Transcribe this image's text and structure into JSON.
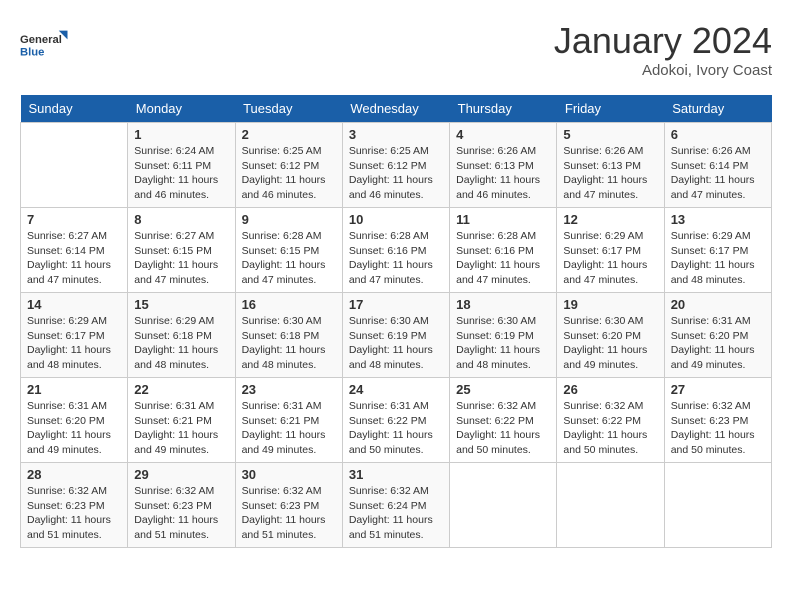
{
  "header": {
    "logo_line1": "General",
    "logo_line2": "Blue",
    "month_year": "January 2024",
    "location": "Adokoi, Ivory Coast"
  },
  "days_of_week": [
    "Sunday",
    "Monday",
    "Tuesday",
    "Wednesday",
    "Thursday",
    "Friday",
    "Saturday"
  ],
  "weeks": [
    [
      {
        "num": "",
        "sunrise": "",
        "sunset": "",
        "daylight": ""
      },
      {
        "num": "1",
        "sunrise": "Sunrise: 6:24 AM",
        "sunset": "Sunset: 6:11 PM",
        "daylight": "Daylight: 11 hours and 46 minutes."
      },
      {
        "num": "2",
        "sunrise": "Sunrise: 6:25 AM",
        "sunset": "Sunset: 6:12 PM",
        "daylight": "Daylight: 11 hours and 46 minutes."
      },
      {
        "num": "3",
        "sunrise": "Sunrise: 6:25 AM",
        "sunset": "Sunset: 6:12 PM",
        "daylight": "Daylight: 11 hours and 46 minutes."
      },
      {
        "num": "4",
        "sunrise": "Sunrise: 6:26 AM",
        "sunset": "Sunset: 6:13 PM",
        "daylight": "Daylight: 11 hours and 46 minutes."
      },
      {
        "num": "5",
        "sunrise": "Sunrise: 6:26 AM",
        "sunset": "Sunset: 6:13 PM",
        "daylight": "Daylight: 11 hours and 47 minutes."
      },
      {
        "num": "6",
        "sunrise": "Sunrise: 6:26 AM",
        "sunset": "Sunset: 6:14 PM",
        "daylight": "Daylight: 11 hours and 47 minutes."
      }
    ],
    [
      {
        "num": "7",
        "sunrise": "Sunrise: 6:27 AM",
        "sunset": "Sunset: 6:14 PM",
        "daylight": "Daylight: 11 hours and 47 minutes."
      },
      {
        "num": "8",
        "sunrise": "Sunrise: 6:27 AM",
        "sunset": "Sunset: 6:15 PM",
        "daylight": "Daylight: 11 hours and 47 minutes."
      },
      {
        "num": "9",
        "sunrise": "Sunrise: 6:28 AM",
        "sunset": "Sunset: 6:15 PM",
        "daylight": "Daylight: 11 hours and 47 minutes."
      },
      {
        "num": "10",
        "sunrise": "Sunrise: 6:28 AM",
        "sunset": "Sunset: 6:16 PM",
        "daylight": "Daylight: 11 hours and 47 minutes."
      },
      {
        "num": "11",
        "sunrise": "Sunrise: 6:28 AM",
        "sunset": "Sunset: 6:16 PM",
        "daylight": "Daylight: 11 hours and 47 minutes."
      },
      {
        "num": "12",
        "sunrise": "Sunrise: 6:29 AM",
        "sunset": "Sunset: 6:17 PM",
        "daylight": "Daylight: 11 hours and 47 minutes."
      },
      {
        "num": "13",
        "sunrise": "Sunrise: 6:29 AM",
        "sunset": "Sunset: 6:17 PM",
        "daylight": "Daylight: 11 hours and 48 minutes."
      }
    ],
    [
      {
        "num": "14",
        "sunrise": "Sunrise: 6:29 AM",
        "sunset": "Sunset: 6:17 PM",
        "daylight": "Daylight: 11 hours and 48 minutes."
      },
      {
        "num": "15",
        "sunrise": "Sunrise: 6:29 AM",
        "sunset": "Sunset: 6:18 PM",
        "daylight": "Daylight: 11 hours and 48 minutes."
      },
      {
        "num": "16",
        "sunrise": "Sunrise: 6:30 AM",
        "sunset": "Sunset: 6:18 PM",
        "daylight": "Daylight: 11 hours and 48 minutes."
      },
      {
        "num": "17",
        "sunrise": "Sunrise: 6:30 AM",
        "sunset": "Sunset: 6:19 PM",
        "daylight": "Daylight: 11 hours and 48 minutes."
      },
      {
        "num": "18",
        "sunrise": "Sunrise: 6:30 AM",
        "sunset": "Sunset: 6:19 PM",
        "daylight": "Daylight: 11 hours and 48 minutes."
      },
      {
        "num": "19",
        "sunrise": "Sunrise: 6:30 AM",
        "sunset": "Sunset: 6:20 PM",
        "daylight": "Daylight: 11 hours and 49 minutes."
      },
      {
        "num": "20",
        "sunrise": "Sunrise: 6:31 AM",
        "sunset": "Sunset: 6:20 PM",
        "daylight": "Daylight: 11 hours and 49 minutes."
      }
    ],
    [
      {
        "num": "21",
        "sunrise": "Sunrise: 6:31 AM",
        "sunset": "Sunset: 6:20 PM",
        "daylight": "Daylight: 11 hours and 49 minutes."
      },
      {
        "num": "22",
        "sunrise": "Sunrise: 6:31 AM",
        "sunset": "Sunset: 6:21 PM",
        "daylight": "Daylight: 11 hours and 49 minutes."
      },
      {
        "num": "23",
        "sunrise": "Sunrise: 6:31 AM",
        "sunset": "Sunset: 6:21 PM",
        "daylight": "Daylight: 11 hours and 49 minutes."
      },
      {
        "num": "24",
        "sunrise": "Sunrise: 6:31 AM",
        "sunset": "Sunset: 6:22 PM",
        "daylight": "Daylight: 11 hours and 50 minutes."
      },
      {
        "num": "25",
        "sunrise": "Sunrise: 6:32 AM",
        "sunset": "Sunset: 6:22 PM",
        "daylight": "Daylight: 11 hours and 50 minutes."
      },
      {
        "num": "26",
        "sunrise": "Sunrise: 6:32 AM",
        "sunset": "Sunset: 6:22 PM",
        "daylight": "Daylight: 11 hours and 50 minutes."
      },
      {
        "num": "27",
        "sunrise": "Sunrise: 6:32 AM",
        "sunset": "Sunset: 6:23 PM",
        "daylight": "Daylight: 11 hours and 50 minutes."
      }
    ],
    [
      {
        "num": "28",
        "sunrise": "Sunrise: 6:32 AM",
        "sunset": "Sunset: 6:23 PM",
        "daylight": "Daylight: 11 hours and 51 minutes."
      },
      {
        "num": "29",
        "sunrise": "Sunrise: 6:32 AM",
        "sunset": "Sunset: 6:23 PM",
        "daylight": "Daylight: 11 hours and 51 minutes."
      },
      {
        "num": "30",
        "sunrise": "Sunrise: 6:32 AM",
        "sunset": "Sunset: 6:23 PM",
        "daylight": "Daylight: 11 hours and 51 minutes."
      },
      {
        "num": "31",
        "sunrise": "Sunrise: 6:32 AM",
        "sunset": "Sunset: 6:24 PM",
        "daylight": "Daylight: 11 hours and 51 minutes."
      },
      {
        "num": "",
        "sunrise": "",
        "sunset": "",
        "daylight": ""
      },
      {
        "num": "",
        "sunrise": "",
        "sunset": "",
        "daylight": ""
      },
      {
        "num": "",
        "sunrise": "",
        "sunset": "",
        "daylight": ""
      }
    ]
  ]
}
